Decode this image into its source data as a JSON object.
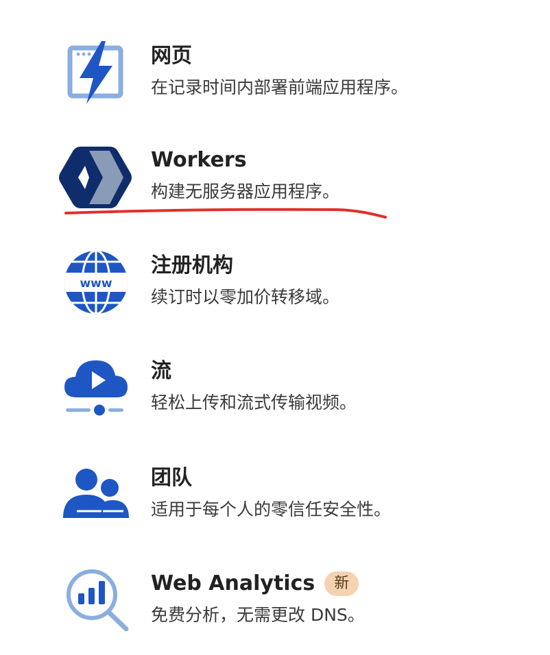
{
  "products": [
    {
      "icon": "lightning-page-icon",
      "title": "网页",
      "description": "在记录时间内部署前端应用程序。"
    },
    {
      "icon": "workers-logo-icon",
      "title": "Workers",
      "description": "构建无服务器应用程序。"
    },
    {
      "icon": "globe-www-icon",
      "title": "注册机构",
      "description": "续订时以零加价转移域。"
    },
    {
      "icon": "cloud-play-icon",
      "title": "流",
      "description": "轻松上传和流式传输视频。"
    },
    {
      "icon": "team-people-icon",
      "title": "团队",
      "description": "适用于每个人的零信任安全性。"
    },
    {
      "icon": "analytics-magnifier-icon",
      "title": "Web Analytics",
      "badge": "新",
      "description": "免费分析，无需更改 DNS。"
    }
  ],
  "colors": {
    "icon_blue": "#1e56c4",
    "icon_light_blue": "#8aaee0",
    "badge_bg": "#f5d3b1",
    "annotation_red": "#e0302a"
  }
}
